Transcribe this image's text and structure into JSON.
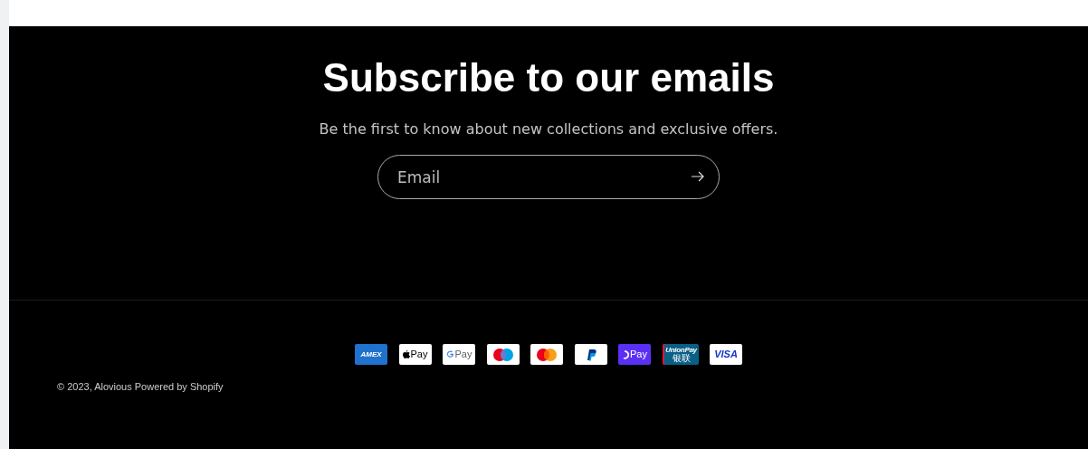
{
  "newsletter": {
    "title": "Subscribe to our emails",
    "subtitle": "Be the first to know about new collections and exclusive offers.",
    "email_field": {
      "placeholder": "Email"
    }
  },
  "payment_icons": [
    {
      "kind": "amex",
      "label": "AMEX"
    },
    {
      "kind": "applepay",
      "label": "Pay"
    },
    {
      "kind": "googlepay",
      "label": "Pay"
    },
    {
      "kind": "maestro"
    },
    {
      "kind": "mastercard"
    },
    {
      "kind": "paypal"
    },
    {
      "kind": "shoppay",
      "label": "Pay"
    },
    {
      "kind": "unionpay",
      "label": "UnionPay",
      "sublabel": "银联"
    },
    {
      "kind": "visa",
      "label": "VISA"
    }
  ],
  "footer": {
    "copyright": "© 2023, Alovious Powered by Shopify"
  }
}
